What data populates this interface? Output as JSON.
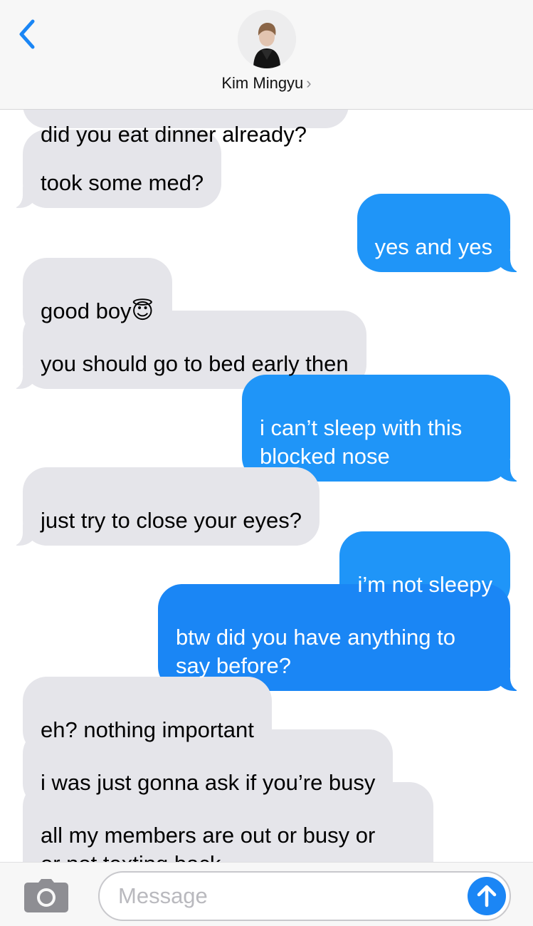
{
  "header": {
    "contact_name": "Kim Mingyu",
    "chevron": "›",
    "icons": {
      "back": "chevron-left-icon",
      "avatar": "contact-photo"
    }
  },
  "thread": {
    "cut_off_message": "did you eat dinner already?",
    "messages": [
      {
        "dir": "in",
        "text": "took some med?"
      },
      {
        "dir": "out",
        "text": "yes and yes"
      },
      {
        "dir": "in",
        "text": "good boy",
        "emoji": "😇"
      },
      {
        "dir": "in",
        "text": "you should go to bed early then"
      },
      {
        "dir": "out",
        "text": "i can’t sleep with this\nblocked nose"
      },
      {
        "dir": "in",
        "text": "just try to close your eyes?"
      },
      {
        "dir": "out",
        "text": "i’m not sleepy"
      },
      {
        "dir": "out",
        "text": "btw did you have anything to\nsay before?"
      },
      {
        "dir": "in",
        "text": "eh? nothing important"
      },
      {
        "dir": "in",
        "text": "i was just gonna ask if you’re busy"
      },
      {
        "dir": "in",
        "text": "all my members are out or busy or\nor not texting back"
      }
    ]
  },
  "composer": {
    "placeholder": "Message",
    "icons": {
      "camera": "camera-icon",
      "send": "arrow-up-icon"
    }
  },
  "colors": {
    "incoming_bubble": "#e5e5ea",
    "outgoing_bubble": "#1f95f8",
    "accent": "#1b86f5",
    "header_bg": "#f7f7f7"
  }
}
